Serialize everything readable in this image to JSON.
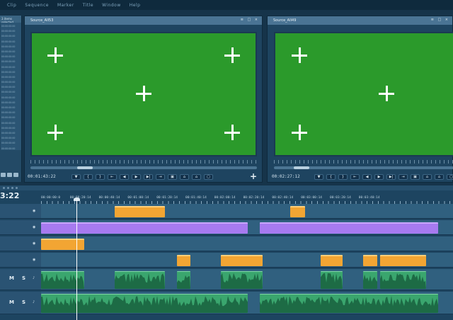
{
  "menu": [
    "Clip",
    "Sequence",
    "Marker",
    "Title",
    "Window",
    "Help"
  ],
  "project_panel": {
    "header": "3 items selected",
    "timecodes": [
      "00:00:00:00",
      "00:00:00:00",
      "00:00:00:00",
      "00:00:00:00",
      "00:00:00:00",
      "00:00:00:00",
      "00:00:00:00",
      "00:00:00:00",
      "00:00:00:00",
      "00:00:00:00",
      "00:00:00:00",
      "00:00:00:00",
      "00:00:00:00",
      "00:00:00:00",
      "00:00:00:00",
      "00:00:00:00",
      "00:00:00:00",
      "00:00:00:00",
      "00:00:00:00",
      "00:00:00:00",
      "00:00:00:00",
      "00:00:00:00",
      "00:00:00:00",
      "00:00:00:00",
      "00:00:00:00"
    ]
  },
  "monitors": [
    {
      "title": "Source_AII53",
      "timecode": "00:01:43:22",
      "scroll_position": 0.22
    },
    {
      "title": "Source_AII49",
      "timecode": "00:02:27:12",
      "scroll_position": 0.12
    }
  ],
  "window_buttons": "≡ □ ×",
  "transport_icons": [
    "marker-icon",
    "in-point-icon",
    "out-point-icon",
    "go-to-in-icon",
    "step-back-icon",
    "play-icon",
    "step-forward-icon",
    "go-to-out-icon",
    "insert-icon",
    "lift-icon",
    "extract-icon",
    "export-frame-icon"
  ],
  "transport_glyphs": [
    "▼",
    "{",
    "}",
    "⇤",
    "◀",
    "▶",
    "▶|",
    "⇥",
    "▣",
    "⌂",
    "⌂",
    "▢"
  ],
  "add_button": "+",
  "timeline": {
    "timecode": "3:22",
    "ruler_labels": [
      "00:00:00:0",
      "00:00:20:14",
      "00:00:40:14",
      "00:01:00:14",
      "00:01:20:14",
      "00:01:40:14",
      "00:02:00:14",
      "00:02:20:14",
      "00:02:40:14",
      "00:03:00:14",
      "00:03:20:14",
      "00:03:40:14"
    ],
    "mute_label": "M",
    "solo_label": "S",
    "eye_glyph": "◉",
    "audio_glyph": "♪"
  },
  "colors": {
    "video_orange": "#f2a533",
    "video_purple": "#a77af0",
    "audio_green": "#3aa66e",
    "screen_green": "#2b9a2b"
  }
}
